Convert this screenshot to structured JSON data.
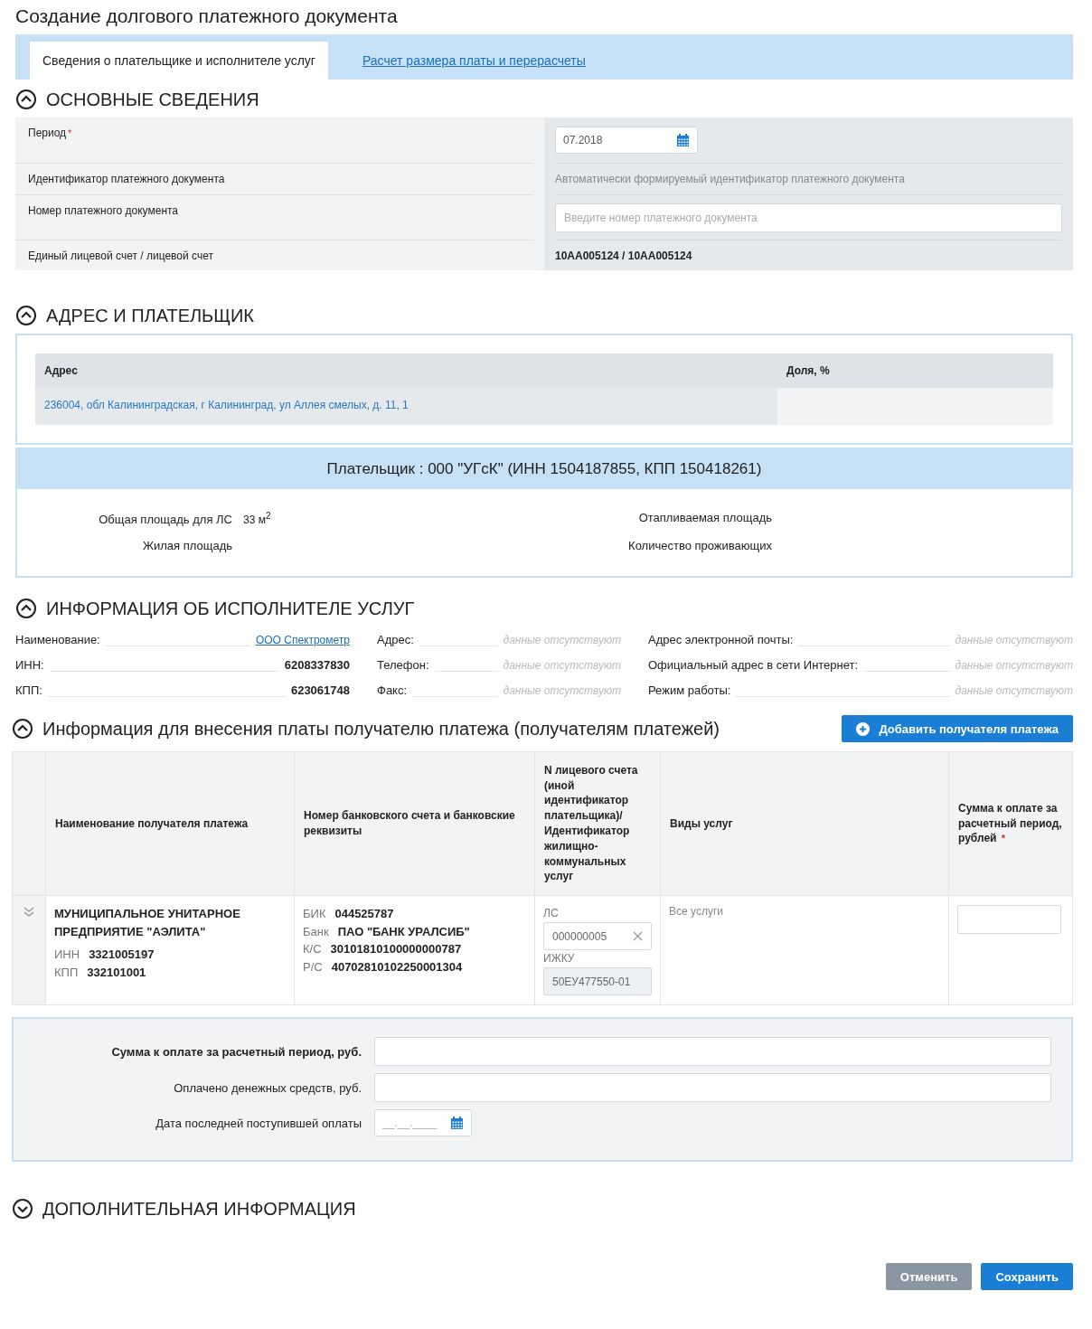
{
  "title": "Создание долгового платежного документа",
  "tabs": [
    {
      "label": "Сведения о плательщике и исполнителе услуг",
      "selected": true
    },
    {
      "label": "Расчет размера платы и перерасчеты",
      "selected": false
    }
  ],
  "main_info": {
    "title": "ОСНОВНЫЕ СВЕДЕНИЯ",
    "expanded": true,
    "rows": [
      {
        "label": "Период",
        "mark": "*",
        "kind": "date",
        "value": "07.2018"
      },
      {
        "label": "Идентификатор платежного документа",
        "kind": "text",
        "value": "Автоматически формируемый идентификатор платежного документа"
      },
      {
        "label": "Номер платежного документа",
        "kind": "input",
        "placeholder": "Введите номер платежного документа"
      },
      {
        "label": "Единый лицевой счет / лицевой счет",
        "kind": "bold",
        "value": "10АА005124 / 10АА005124"
      }
    ]
  },
  "address_payer": {
    "title": "АДРЕС И ПЛАТЕЛЬЩИК",
    "expanded": true,
    "columns": [
      "Адрес",
      "Доля, %"
    ],
    "rows": [
      {
        "address": "236004, обл Калининградская, г Калининград, ул Аллея смелых, д. 11, 1"
      }
    ],
    "payer": "Плательщик : 000 \"УГсК\" (ИНН 1504187855, КПП 150418261)",
    "fields": [
      {
        "label": "Общая площадь для ЛС",
        "value": "33 м$^{2}$"
      },
      {
        "label": "Отапливаемая площадь"
      },
      {
        "label": "Жилая площадь"
      },
      {
        "label": "Количество проживающих"
      }
    ]
  },
  "contractor": {
    "title": "ИНФОРМАЦИЯ ОБ ИСПОЛНИТЕЛЕ УСЛУГ",
    "expanded": true,
    "fields": [
      {
        "label": "Наименование:",
        "value": "ООО Спектрометр",
        "kind": "link"
      },
      {
        "label": "Адрес:",
        "value": "данные отсутствуют",
        "kind": "empty"
      },
      {
        "label": "Адрес электронной почты:",
        "value": "данные отсутствуют",
        "kind": "empty"
      },
      {
        "label": "ИНН:",
        "value": "6208337830",
        "kind": "bold"
      },
      {
        "label": "Телефон:",
        "value": "данные отсутствуют",
        "kind": "empty"
      },
      {
        "label": "Официальный адрес в сети Интернет:",
        "value": "данные отсутствуют",
        "kind": "empty"
      },
      {
        "label": "КПП:",
        "value": "623061748",
        "kind": "bold"
      },
      {
        "label": "Факс:",
        "value": "данные отсутствуют",
        "kind": "empty"
      },
      {
        "label": "Режим работы:",
        "value": "данные отсутствуют",
        "kind": "empty"
      }
    ]
  },
  "recipients": {
    "title": "Информация для внесения платы получателю платежа (получателям платежей)",
    "expanded": true,
    "add_button": "Добавить получателя платежа",
    "columns": [
      {
        "label": "Наименование получателя платежа"
      },
      {
        "label": "Номер банковского счета и банковские реквизиты"
      },
      {
        "label": "N лицевого счета (иной идентификатор плательщика)/ Идентификатор жилищно-коммунальных услуг"
      },
      {
        "label": "Виды услуг"
      },
      {
        "label": "Сумма к оплате за расчетный период, рублей",
        "mark": "*"
      }
    ],
    "rows": [
      {
        "expanded": false,
        "name": "МУНИЦИПАЛЬНОЕ УНИТАРНОЕ ПРЕДПРИЯТИЕ \"АЭЛИТА\"",
        "ids": [
          {
            "label": "ИНН",
            "value": "3321005197"
          },
          {
            "label": "КПП",
            "value": "332101001"
          }
        ],
        "bank": [
          {
            "label": "БИК",
            "value": "044525787"
          },
          {
            "label": "Банк",
            "value": "ПАО \"БАНК УРАЛСИБ\""
          },
          {
            "label": "К/С",
            "value": "30101810100000000787"
          },
          {
            "label": "Р/С",
            "value": "40702810102250001304"
          }
        ],
        "ls_label": "ЛС",
        "ls_value": "000000005",
        "izhku_label": "ИЖКУ",
        "izhku_value": "50ЕУ477550-01",
        "services": "Все услуги"
      }
    ]
  },
  "totals": [
    {
      "label": "Сумма к оплате за расчетный период, руб.",
      "bold": true,
      "kind": "input"
    },
    {
      "label": "Оплачено денежных средств, руб.",
      "bold": false,
      "kind": "input"
    },
    {
      "label": "Дата последней поступившей оплаты",
      "bold": false,
      "kind": "date",
      "placeholder": "__.__.____"
    }
  ],
  "additional": {
    "title": "ДОПОЛНИТЕЛЬНАЯ ИНФОРМАЦИЯ",
    "expanded": false
  },
  "buttons": [
    {
      "label": "Отменить",
      "kind": "secondary"
    },
    {
      "label": "Сохранить",
      "kind": "primary"
    }
  ]
}
